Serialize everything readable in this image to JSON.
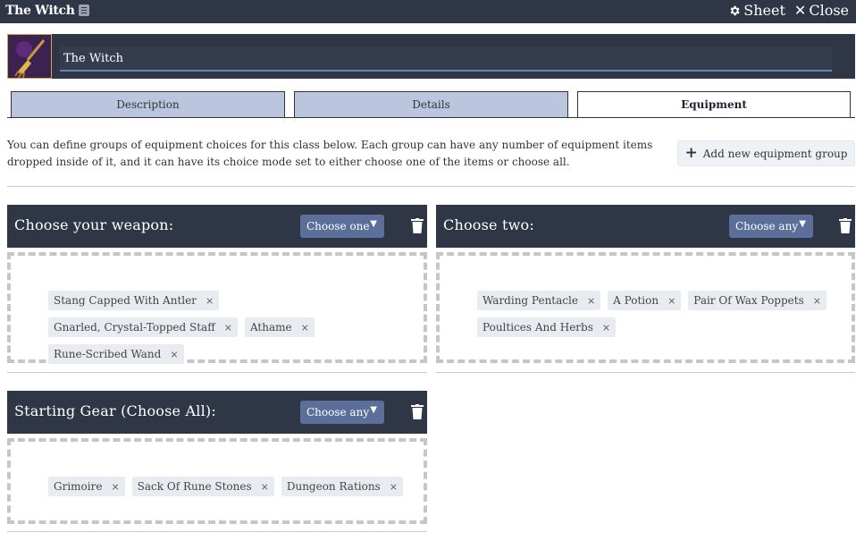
{
  "window": {
    "title": "The Witch",
    "sheet_label": "Sheet",
    "close_label": "Close"
  },
  "header": {
    "name_value": "The Witch"
  },
  "tabs": [
    {
      "label": "Description",
      "active": false
    },
    {
      "label": "Details",
      "active": false
    },
    {
      "label": "Equipment",
      "active": true
    }
  ],
  "equipment": {
    "intro": "You can define groups of equipment choices for this class below. Each group can have any number of equipment items dropped inside of it, and it can have its choice mode set to either choose one of the items or choose all.",
    "add_group_label": "Add new equipment group",
    "groups": [
      {
        "title": "Choose your weapon:",
        "mode": "Choose one",
        "items": [
          "Stang Capped With Antler",
          "Gnarled, Crystal-Topped Staff",
          "Athame",
          "Rune-Scribed Wand"
        ]
      },
      {
        "title": "Choose two:",
        "mode": "Choose any",
        "items": [
          "Warding Pentacle",
          "A Potion",
          "Pair Of Wax Poppets",
          "Poultices And Herbs"
        ]
      },
      {
        "title": "Starting Gear (Choose All):",
        "mode": "Choose any",
        "items": [
          "Grimoire",
          "Sack Of Rune Stones",
          "Dungeon Rations"
        ]
      }
    ]
  },
  "colors": {
    "header_bg": "#2f3747",
    "tab_inactive": "#b9c6dd",
    "select_bg": "#5b6f9a",
    "chip_bg": "#e8ecf1"
  }
}
